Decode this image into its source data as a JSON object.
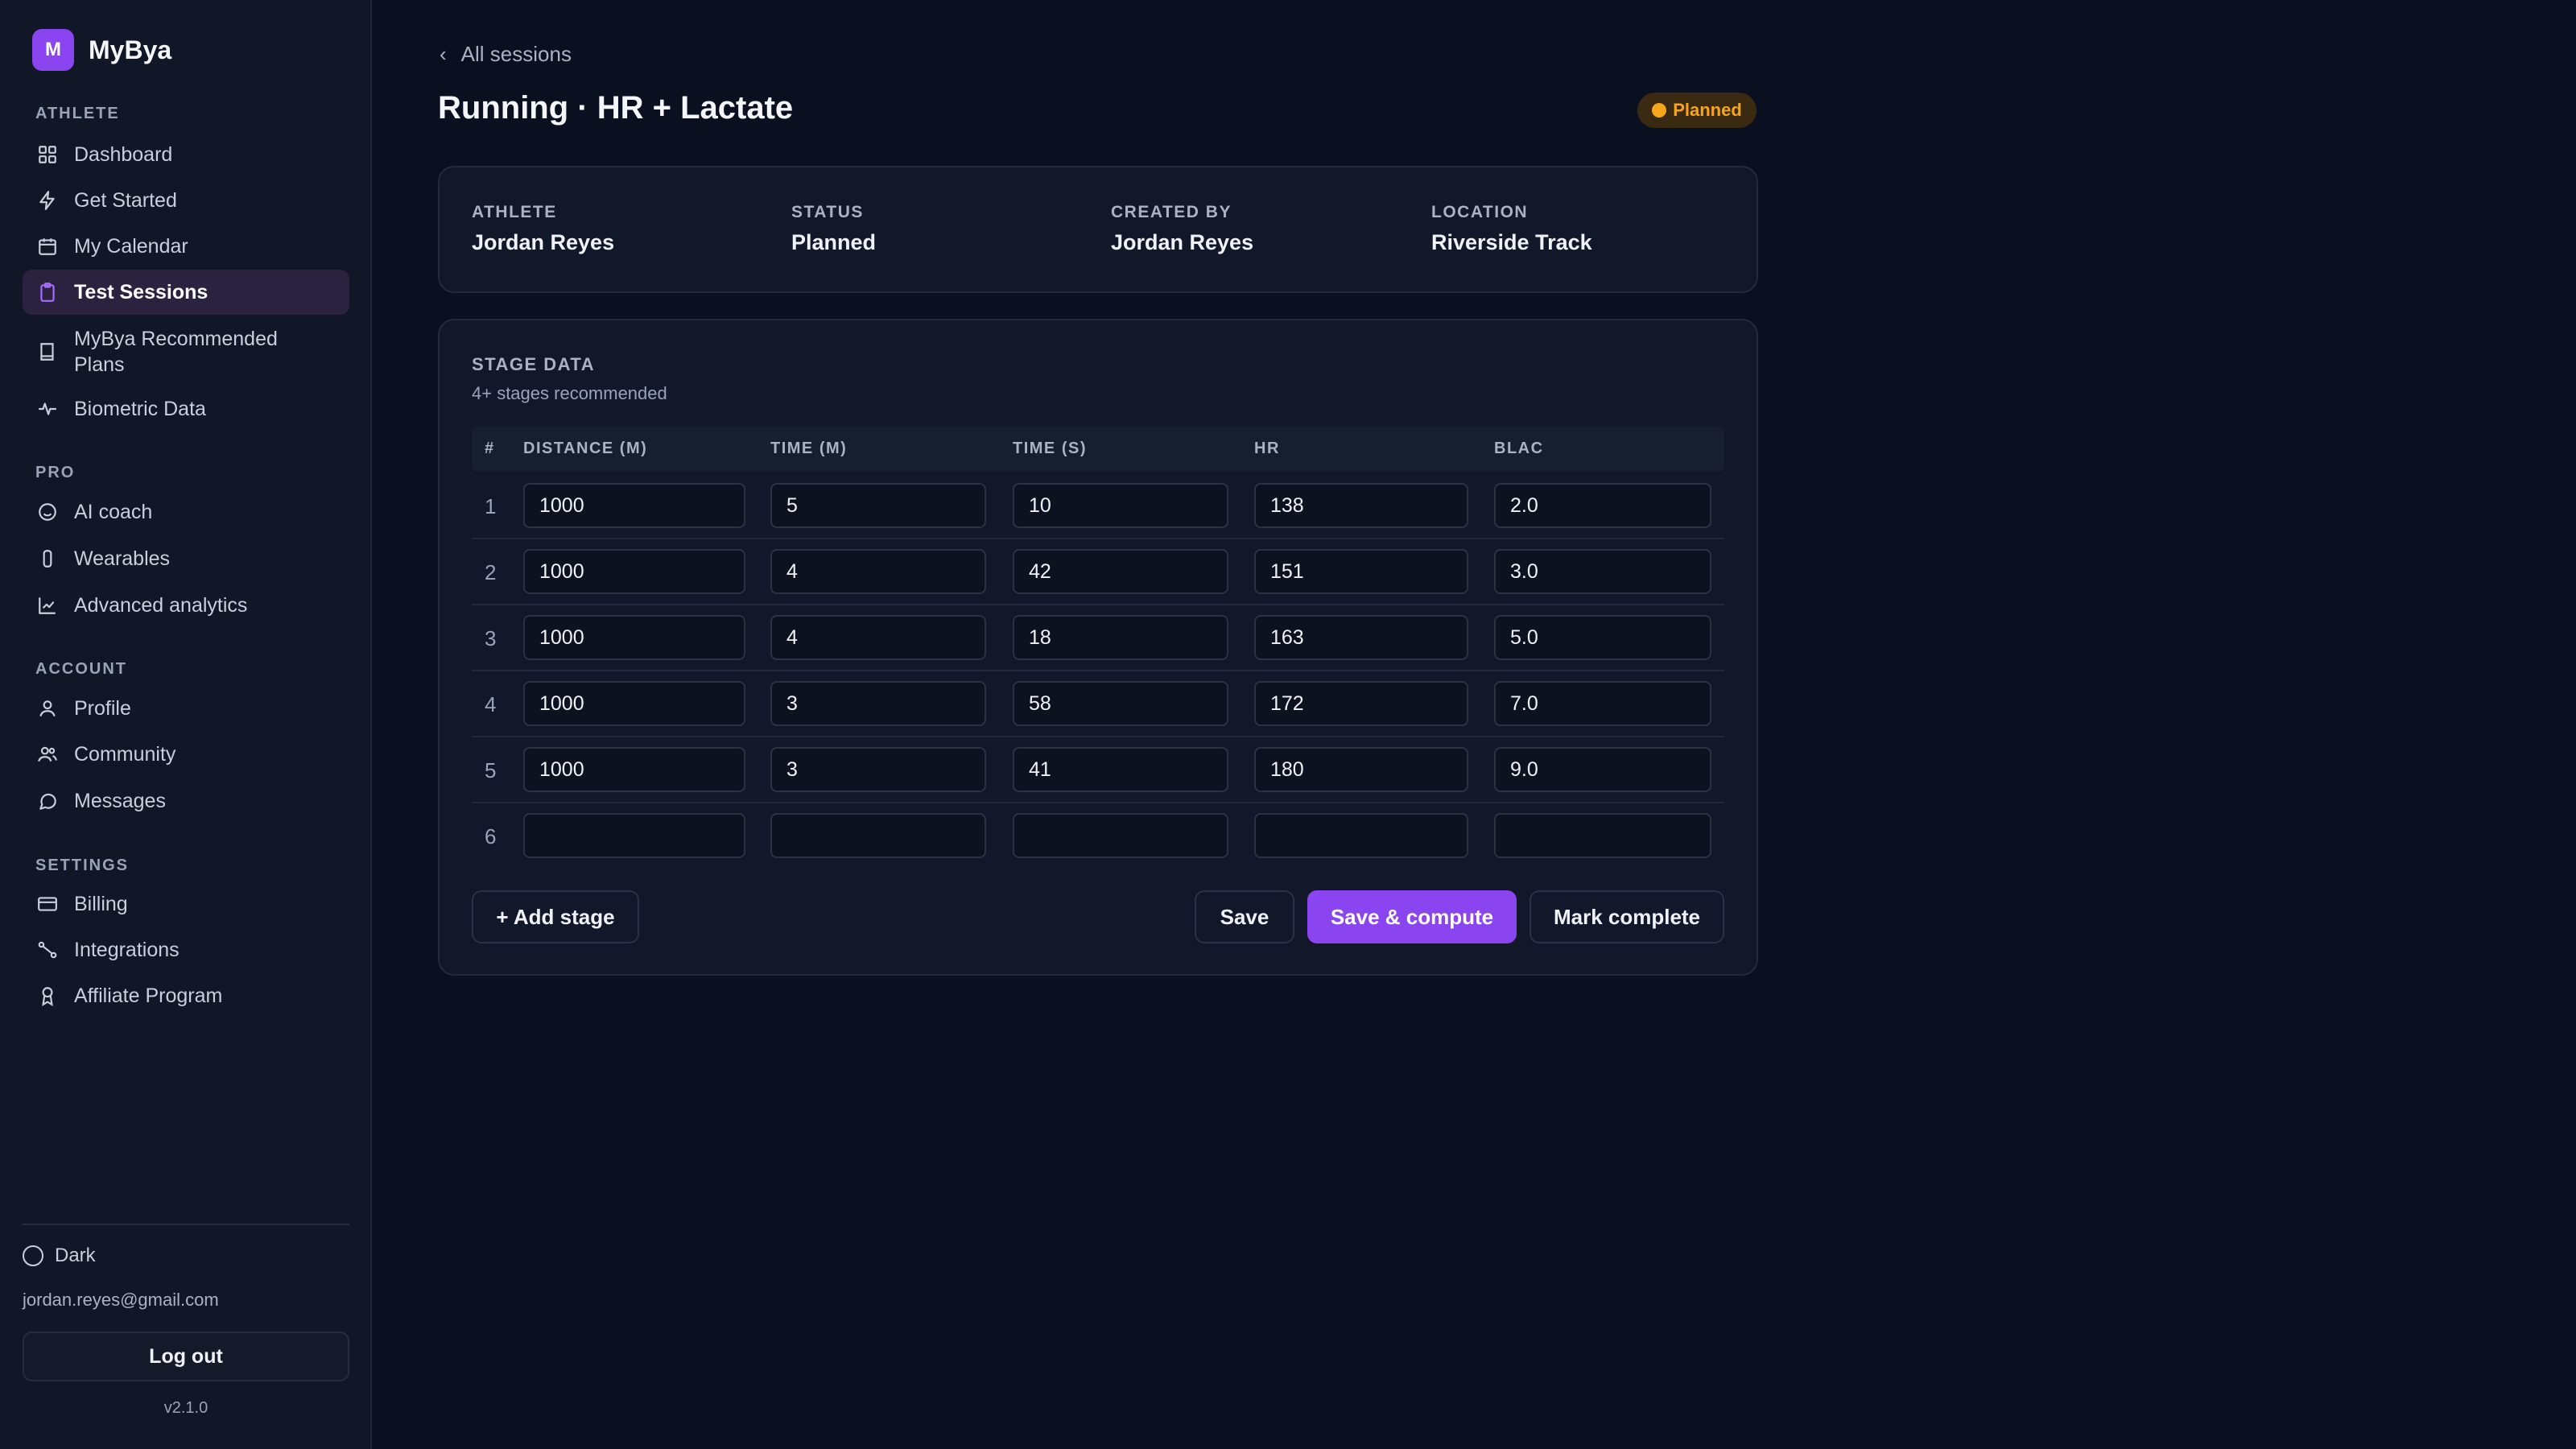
{
  "brand": {
    "logo_letter": "M",
    "name": "MyBya"
  },
  "sidebar": {
    "sections": [
      {
        "label": "ATHLETE"
      },
      {
        "label": "PRO"
      },
      {
        "label": "ACCOUNT"
      },
      {
        "label": "SETTINGS"
      }
    ],
    "items": [
      {
        "label": "Dashboard",
        "icon": "dashboard-icon"
      },
      {
        "label": "Get Started",
        "icon": "bolt-icon"
      },
      {
        "label": "My Calendar",
        "icon": "calendar-icon"
      },
      {
        "label": "Test Sessions",
        "icon": "clipboard-icon",
        "active": true
      },
      {
        "label": "MyBya Recommended Plans",
        "icon": "book-icon"
      },
      {
        "label": "Biometric Data",
        "icon": "pulse-icon"
      },
      {
        "label": "AI coach",
        "icon": "smile-icon"
      },
      {
        "label": "Wearables",
        "icon": "watch-icon"
      },
      {
        "label": "Advanced analytics",
        "icon": "chart-icon"
      },
      {
        "label": "Profile",
        "icon": "user-icon"
      },
      {
        "label": "Community",
        "icon": "users-icon"
      },
      {
        "label": "Messages",
        "icon": "message-icon"
      },
      {
        "label": "Billing",
        "icon": "card-icon"
      },
      {
        "label": "Integrations",
        "icon": "link-icon"
      },
      {
        "label": "Affiliate Program",
        "icon": "award-icon"
      }
    ],
    "theme_label": "Dark",
    "user_email": "jordan.reyes@gmail.com",
    "logout_label": "Log out",
    "version": "v2.1.0"
  },
  "header": {
    "back_label": "All sessions",
    "title": "Running · HR + Lactate",
    "status_badge": "Planned",
    "status_color": "#f6a51c"
  },
  "info": [
    {
      "key": "ATHLETE",
      "value": "Jordan Reyes"
    },
    {
      "key": "STATUS",
      "value": "Planned"
    },
    {
      "key": "CREATED BY",
      "value": "Jordan Reyes"
    },
    {
      "key": "LOCATION",
      "value": "Riverside Track"
    }
  ],
  "stage": {
    "title": "STAGE DATA",
    "subtitle": "4+ stages recommended",
    "columns": [
      "#",
      "DISTANCE (M)",
      "TIME (M)",
      "TIME (S)",
      "HR",
      "BLAC"
    ],
    "rows": [
      {
        "n": "1",
        "distance": "1000",
        "time_m": "5",
        "time_s": "10",
        "hr": "138",
        "blac": "2.0"
      },
      {
        "n": "2",
        "distance": "1000",
        "time_m": "4",
        "time_s": "42",
        "hr": "151",
        "blac": "3.0"
      },
      {
        "n": "3",
        "distance": "1000",
        "time_m": "4",
        "time_s": "18",
        "hr": "163",
        "blac": "5.0"
      },
      {
        "n": "4",
        "distance": "1000",
        "time_m": "3",
        "time_s": "58",
        "hr": "172",
        "blac": "7.0"
      },
      {
        "n": "5",
        "distance": "1000",
        "time_m": "3",
        "time_s": "41",
        "hr": "180",
        "blac": "9.0"
      },
      {
        "n": "6",
        "distance": "",
        "time_m": "",
        "time_s": "",
        "hr": "",
        "blac": ""
      }
    ],
    "add_stage_label": "+ Add stage",
    "save_label": "Save",
    "save_compute_label": "Save & compute",
    "mark_complete_label": "Mark complete"
  },
  "colors": {
    "accent": "#8b45f0",
    "background": "#0b1020",
    "sidebar": "#111726",
    "warning": "#f6a51c"
  }
}
